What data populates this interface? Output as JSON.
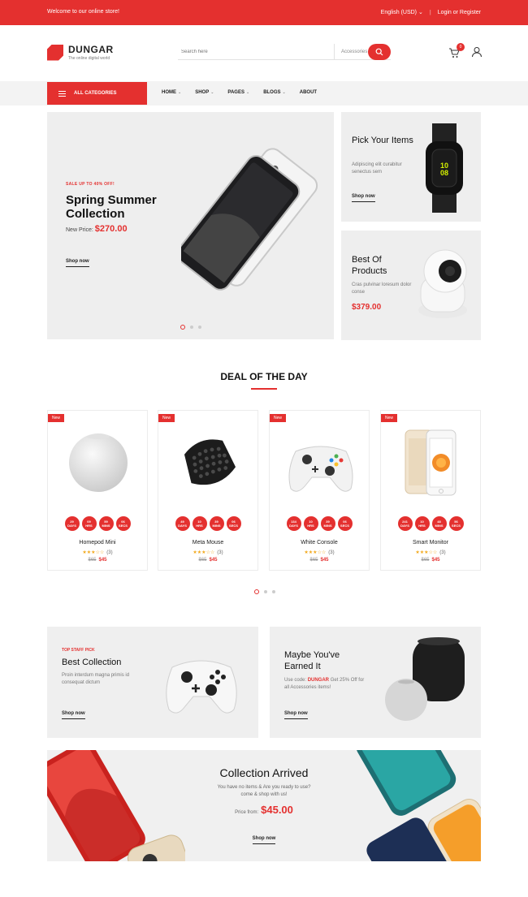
{
  "topbar": {
    "welcome": "Welcome to our online store!",
    "language": "English (USD)",
    "login": "Login or Register"
  },
  "brand": {
    "name": "DUNGAR",
    "tagline": "The online digital world"
  },
  "search": {
    "placeholder": "Search here",
    "category": "Accessories",
    "cart_count": "0"
  },
  "nav": {
    "all_categories": "ALL CATEGORIES",
    "links": [
      "HOME",
      "SHOP",
      "PAGES",
      "BLOGS",
      "ABOUT"
    ]
  },
  "hero": {
    "sale": "SALE UP TO 40% OFF!",
    "title": "Spring Summer Collection",
    "price_label": "New Price:",
    "price": "$270.00",
    "cta": "Shop now"
  },
  "side_banners": [
    {
      "title": "Pick Your Items",
      "desc": "Adipiscing elit curabitur senectus sem",
      "cta": "Shop now"
    },
    {
      "title": "Best Of Products",
      "desc": "Cras pulvinar loresum dolor conse",
      "price": "$379.00"
    }
  ],
  "deal": {
    "title": "DEAL OF THE DAY",
    "products": [
      {
        "badge": "New",
        "name": "Homepod Mini",
        "reviews": "(3)",
        "old_price": "$65",
        "price": "$45",
        "rating": 3,
        "timer": [
          [
            "29",
            "DAYS"
          ],
          [
            "09",
            "HRS"
          ],
          [
            "59",
            "MINS"
          ],
          [
            "06",
            "SECS"
          ]
        ]
      },
      {
        "badge": "New",
        "name": "Meta Mouse",
        "reviews": "(3)",
        "old_price": "$65",
        "price": "$45",
        "rating": 3,
        "timer": [
          [
            "49",
            "DAYS"
          ],
          [
            "10",
            "HRS"
          ],
          [
            "39",
            "MINS"
          ],
          [
            "06",
            "SECS"
          ]
        ]
      },
      {
        "badge": "New",
        "name": "White Console",
        "reviews": "(3)",
        "old_price": "$65",
        "price": "$45",
        "rating": 3,
        "timer": [
          [
            "134",
            "DAYS"
          ],
          [
            "10",
            "HRS"
          ],
          [
            "39",
            "MINS"
          ],
          [
            "06",
            "SECS"
          ]
        ]
      },
      {
        "badge": "New",
        "name": "Smart Monitor",
        "reviews": "(3)",
        "old_price": "$65",
        "price": "$45",
        "rating": 3,
        "timer": [
          [
            "241",
            "DAYS"
          ],
          [
            "10",
            "HRS"
          ],
          [
            "48",
            "MINS"
          ],
          [
            "56",
            "SECS"
          ]
        ]
      }
    ]
  },
  "banners": [
    {
      "small": "TOP STAFF PICK",
      "title": "Best Collection",
      "desc": "Proin interdum magna primis id consequat dictum",
      "cta": "Shop now"
    },
    {
      "title": "Maybe You've Earned It",
      "desc_pre": "Use code:",
      "code": "DUNGAR",
      "desc_post": "Get 25% Off for all Accessories items!",
      "cta": "Shop now"
    }
  ],
  "collection": {
    "title": "Collection Arrived",
    "desc": "You have no items & Are you ready to use? come & shop with us!",
    "price_label": "Price from:",
    "price": "$45.00",
    "cta": "Shop now"
  },
  "colors": {
    "accent": "#e4302f",
    "panel": "#eeeeee"
  }
}
